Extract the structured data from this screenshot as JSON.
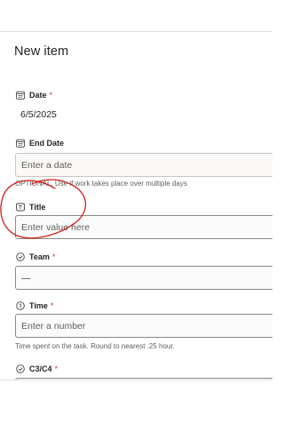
{
  "form": {
    "title": "New item",
    "fields": [
      {
        "label": "Date",
        "required": true,
        "icon": "calendar-icon",
        "value": "6/5/2025",
        "placeholder": "",
        "help": ""
      },
      {
        "label": "End Date",
        "required": false,
        "icon": "calendar-icon",
        "value": "",
        "placeholder": "Enter a date",
        "help": "OPTIONAL. Use if work takes place over multiple days"
      },
      {
        "label": "Title",
        "required": false,
        "icon": "text-icon",
        "value": "",
        "placeholder": "Enter value here",
        "help": ""
      },
      {
        "label": "Team",
        "required": true,
        "icon": "choice-icon",
        "value": "—",
        "placeholder": "",
        "help": ""
      },
      {
        "label": "Time",
        "required": true,
        "icon": "number-icon",
        "value": "",
        "placeholder": "Enter a number",
        "help": "Time spent on the task. Round to nearest .25 hour."
      },
      {
        "label": "C3/C4",
        "required": true,
        "icon": "choice-icon",
        "value": "",
        "placeholder": "",
        "help": ""
      }
    ],
    "required_marker": "*"
  },
  "annotation": {
    "color": "#d0201a",
    "shape": "hand-drawn-circle"
  },
  "colors": {
    "required": "#c4314b",
    "border": "#8a8886"
  }
}
